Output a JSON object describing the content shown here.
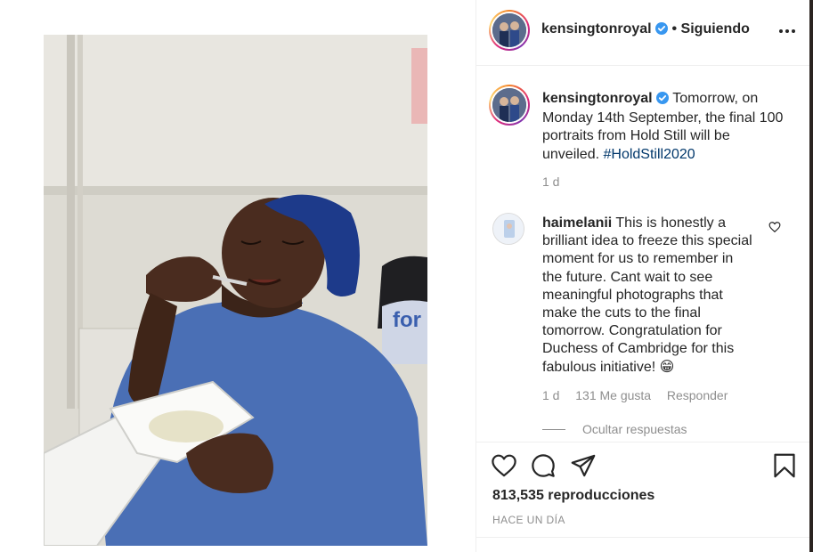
{
  "post": {
    "author": "kensingtonroyal",
    "follow_label": "Siguiendo",
    "follow_separator": "•",
    "caption": {
      "username": "kensingtonroyal",
      "lines": [
        "Tomorrow, on",
        "Monday 14th September, the final 100",
        "portraits from Hold Still will be",
        "unveiled."
      ],
      "hashtag": "#HoldStill2020",
      "age": "1 d"
    },
    "comment": {
      "username": "haimelanii",
      "lines": [
        "This is honestly a",
        "brilliant idea to freeze this special",
        "moment for us to remember in",
        "the future. Cant wait to see",
        "meaningful photographs that",
        "make the cuts to the final",
        "tomorrow. Congratulation for",
        "Duchess of Cambridge for this",
        "fabulous initiative!"
      ],
      "emoji": "😁",
      "age": "1 d",
      "likes": "131 Me gusta",
      "reply_label": "Responder"
    },
    "hide_replies_label": "Ocultar respuestas",
    "views": "813,535 reproducciones",
    "posted": "HACE UN DÍA"
  },
  "icons": {
    "more": "more-options-icon",
    "verified": "verified-badge-icon",
    "like": "heart-icon",
    "comment": "comment-icon",
    "share": "paper-plane-icon",
    "save": "bookmark-icon",
    "comment_like": "small-heart-icon"
  },
  "colors": {
    "text": "#262626",
    "secondary": "#8e8e8e",
    "verified": "#3897f0",
    "hashtag": "#00376b",
    "divider": "#efefef",
    "scrub_blue": "#3a5fae"
  }
}
